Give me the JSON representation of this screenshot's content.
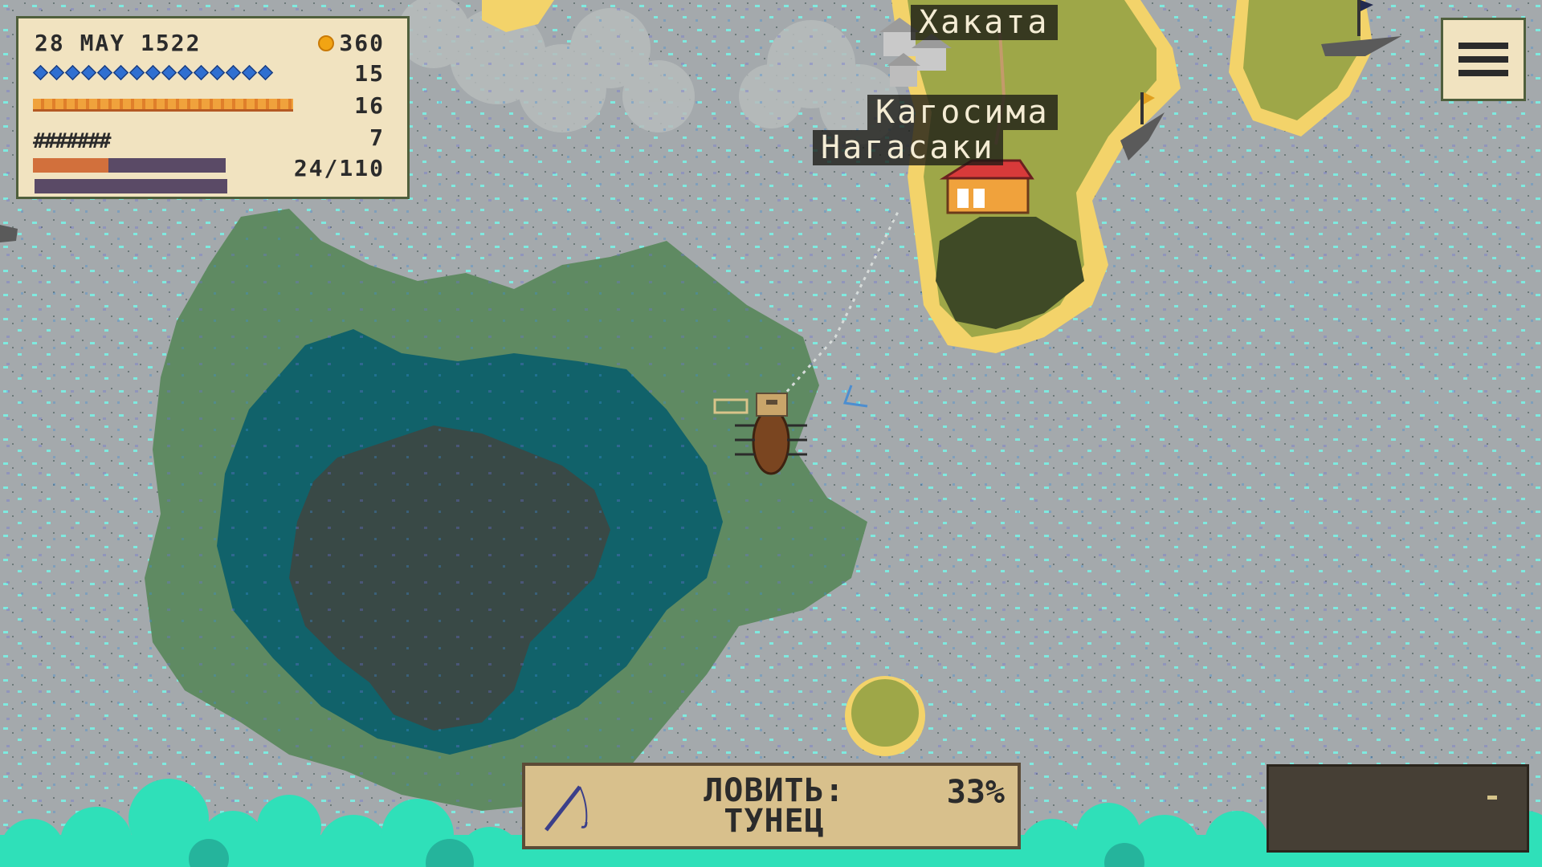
{
  "status": {
    "date": "28 MAY 1522",
    "gold": "360",
    "crew_count": "15",
    "food_count": "16",
    "cannons_strip": "#######",
    "cannons_count": "7",
    "cargo": "24/110",
    "hull_fraction": 0.39,
    "colors": {
      "crew": "#2f6fd1",
      "food": "#f0a23c",
      "hull": "#d2703c",
      "bar_bg": "#5a4a66"
    }
  },
  "cities": [
    {
      "name": "Хаката"
    },
    {
      "name": "Кагосима"
    },
    {
      "name": "Нагасаки"
    }
  ],
  "fishing": {
    "action_line1": "ЛОВИТЬ:",
    "action_line2": "ТУНЕЦ",
    "chance": "33%",
    "icon": "fishing-rod-icon"
  },
  "menu": {
    "icon": "hamburger-menu-icon"
  },
  "minimap": {
    "visible": true
  },
  "map_colors": {
    "sea": "#a4a9ac",
    "shallow": "#5f8a62",
    "deep": "#11626a",
    "abyss": "#394946",
    "land": "#9ea748",
    "forest": "#3f4a26",
    "sand": "#f3d36a",
    "surf": "#2fe0b9"
  }
}
